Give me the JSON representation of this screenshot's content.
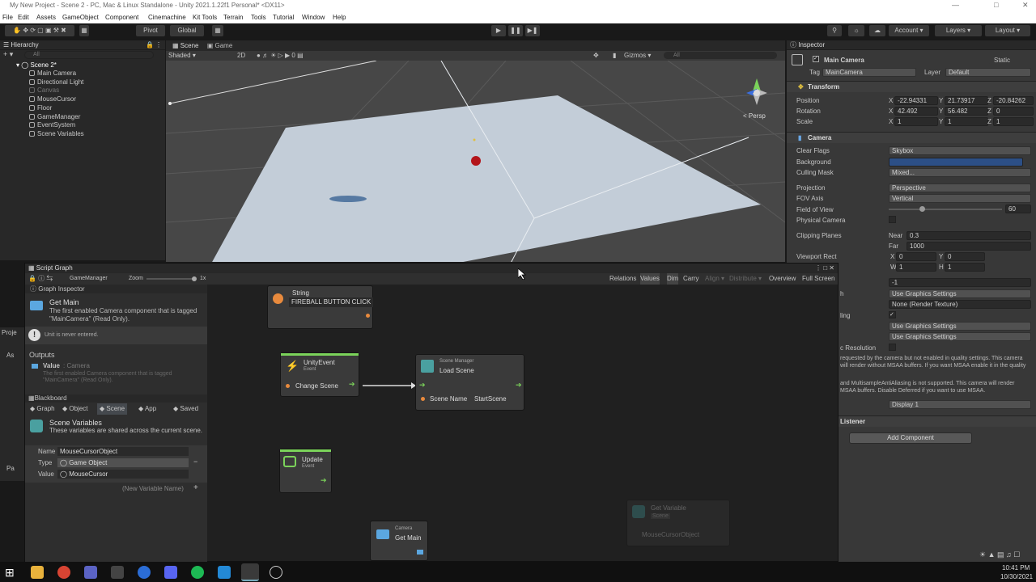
{
  "window": {
    "title": "My New Project - Scene 2 - PC, Mac & Linux Standalone - Unity 2021.1.22f1 Personal* <DX11>"
  },
  "menu": [
    "File",
    "Edit",
    "Assets",
    "GameObject",
    "Component",
    "Cinemachine",
    "Kit Tools",
    "Terrain",
    "Tools",
    "Tutorial",
    "Window",
    "Help"
  ],
  "toolbar": {
    "pivot": "Pivot",
    "global": "Global",
    "account": "Account",
    "layers": "Layers",
    "layout": "Layout"
  },
  "hierarchy": {
    "title": "Hierarchy",
    "search_placeholder": "All",
    "scene": "Scene 2*",
    "items": [
      "Main Camera",
      "Directional Light",
      "Canvas",
      "MouseCursor",
      "Floor",
      "GameManager",
      "EventSystem",
      "Scene Variables"
    ]
  },
  "scene_view": {
    "tab_scene": "Scene",
    "tab_game": "Game",
    "shading": "Shaded",
    "mode": "2D",
    "gizmos": "Gizmos",
    "search": "All",
    "persp": "< Persp"
  },
  "inspector": {
    "title": "Inspector",
    "object_name": "Main Camera",
    "static": "Static",
    "tag_label": "Tag",
    "tag": "MainCamera",
    "layer_label": "Layer",
    "layer": "Default",
    "transform": {
      "title": "Transform",
      "position_label": "Position",
      "position": [
        "-22.94331",
        "21.73917",
        "-20.84262"
      ],
      "rotation_label": "Rotation",
      "rotation": [
        "42.492",
        "56.482",
        "0"
      ],
      "scale_label": "Scale",
      "scale": [
        "1",
        "1",
        "1"
      ]
    },
    "camera": {
      "title": "Camera",
      "clear_flags_label": "Clear Flags",
      "clear_flags": "Skybox",
      "background_label": "Background",
      "background_color": "#2c4f86",
      "culling_label": "Culling Mask",
      "culling": "Mixed...",
      "projection_label": "Projection",
      "projection": "Perspective",
      "fov_axis_label": "FOV Axis",
      "fov_axis": "Vertical",
      "fov_label": "Field of View",
      "fov": "60",
      "fov_level": 0.29,
      "physical_label": "Physical Camera",
      "clipping_label": "Clipping Planes",
      "near_label": "Near",
      "near": "0.3",
      "far_label": "Far",
      "far": "1000",
      "viewport_label": "Viewport Rect",
      "vx": "0",
      "vy": "0",
      "vw": "1",
      "vh": "1",
      "depth": "-1",
      "render_path": "Use Graphics Settings",
      "target": "None (Render Texture)",
      "msaa": "Use Graphics Settings",
      "hdr": "Use Graphics Settings",
      "dyn_res": "c Resolution",
      "warn1": "requested by the camera but not enabled in quality settings. This camera will render without MSAA buffers. If you want MSAA enable it in the quality",
      "warn2": "and MultisampleAntiAliasing is not supported. This camera will render MSAA buffers. Disable Deferred if you want to use MSAA.",
      "display": "Display 1",
      "h": "h",
      "ling": "ling"
    },
    "listener": "Listener",
    "add_component": "Add Component"
  },
  "script_graph": {
    "title": "Script Graph",
    "breadcrumb": "GameManager",
    "zoom": "Zoom",
    "zoom_value": "1x",
    "tools": [
      "Relations",
      "Values",
      "Dim",
      "Carry",
      "Align",
      "Distribute",
      "Overview",
      "Full Screen"
    ],
    "graph_inspector": {
      "title": "Graph Inspector",
      "unit_title": "Get Main",
      "unit_desc": "The first enabled Camera component that is tagged \"MainCamera\" (Read Only).",
      "warning": "Unit is never entered.",
      "outputs": "Outputs",
      "value_label": "Value",
      "value_type": ": Camera",
      "value_desc": "The first enabled Camera component that is tagged \"MainCamera\" (Read Only)."
    },
    "blackboard": {
      "title": "Blackboard",
      "tabs": [
        "Graph",
        "Object",
        "Scene",
        "App",
        "Saved"
      ],
      "section_title": "Scene Variables",
      "section_desc": "These variables are shared across the current scene.",
      "name_label": "Name",
      "name": "MouseCursorObject",
      "type_label": "Type",
      "type": "Game Object",
      "value_label": "Value",
      "value": "MouseCursor",
      "new_var": "(New Variable Name)"
    },
    "nodes": {
      "string": {
        "title": "String",
        "value": "FIREBALL BUTTON CLICK"
      },
      "unity_event": {
        "title": "UnityEvent",
        "subtitle": "Event",
        "port": "Change Scene"
      },
      "scene_manager": {
        "subtitle": "Scene Manager",
        "title": "Load Scene",
        "port_label": "Scene Name",
        "port_value": "StartScene"
      },
      "update": {
        "title": "Update",
        "subtitle": "Event"
      },
      "camera": {
        "subtitle": "Camera",
        "title": "Get Main"
      },
      "get_variable": {
        "title": "Get Variable",
        "scope": "Scene",
        "value": "MouseCursorObject"
      }
    }
  },
  "project": {
    "tab": "Proje",
    "items": [
      "As",
      "Pa"
    ]
  },
  "taskbar": {
    "time": "10:41 PM",
    "date": "10/30/2021"
  }
}
